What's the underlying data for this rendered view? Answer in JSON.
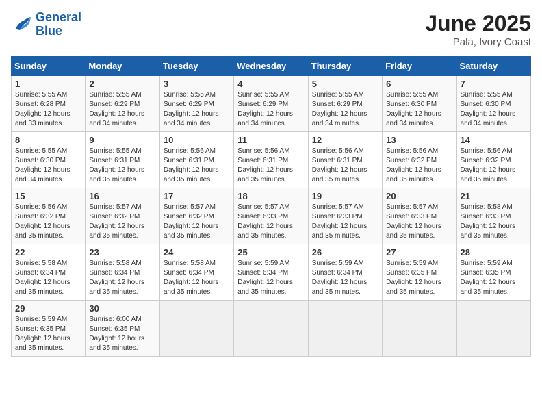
{
  "header": {
    "logo_line1": "General",
    "logo_line2": "Blue",
    "month_year": "June 2025",
    "location": "Pala, Ivory Coast"
  },
  "weekdays": [
    "Sunday",
    "Monday",
    "Tuesday",
    "Wednesday",
    "Thursday",
    "Friday",
    "Saturday"
  ],
  "weeks": [
    [
      {
        "day": "1",
        "sunrise": "5:55 AM",
        "sunset": "6:28 PM",
        "daylight": "12 hours and 33 minutes."
      },
      {
        "day": "2",
        "sunrise": "5:55 AM",
        "sunset": "6:29 PM",
        "daylight": "12 hours and 34 minutes."
      },
      {
        "day": "3",
        "sunrise": "5:55 AM",
        "sunset": "6:29 PM",
        "daylight": "12 hours and 34 minutes."
      },
      {
        "day": "4",
        "sunrise": "5:55 AM",
        "sunset": "6:29 PM",
        "daylight": "12 hours and 34 minutes."
      },
      {
        "day": "5",
        "sunrise": "5:55 AM",
        "sunset": "6:29 PM",
        "daylight": "12 hours and 34 minutes."
      },
      {
        "day": "6",
        "sunrise": "5:55 AM",
        "sunset": "6:30 PM",
        "daylight": "12 hours and 34 minutes."
      },
      {
        "day": "7",
        "sunrise": "5:55 AM",
        "sunset": "6:30 PM",
        "daylight": "12 hours and 34 minutes."
      }
    ],
    [
      {
        "day": "8",
        "sunrise": "5:55 AM",
        "sunset": "6:30 PM",
        "daylight": "12 hours and 34 minutes."
      },
      {
        "day": "9",
        "sunrise": "5:55 AM",
        "sunset": "6:31 PM",
        "daylight": "12 hours and 35 minutes."
      },
      {
        "day": "10",
        "sunrise": "5:56 AM",
        "sunset": "6:31 PM",
        "daylight": "12 hours and 35 minutes."
      },
      {
        "day": "11",
        "sunrise": "5:56 AM",
        "sunset": "6:31 PM",
        "daylight": "12 hours and 35 minutes."
      },
      {
        "day": "12",
        "sunrise": "5:56 AM",
        "sunset": "6:31 PM",
        "daylight": "12 hours and 35 minutes."
      },
      {
        "day": "13",
        "sunrise": "5:56 AM",
        "sunset": "6:32 PM",
        "daylight": "12 hours and 35 minutes."
      },
      {
        "day": "14",
        "sunrise": "5:56 AM",
        "sunset": "6:32 PM",
        "daylight": "12 hours and 35 minutes."
      }
    ],
    [
      {
        "day": "15",
        "sunrise": "5:56 AM",
        "sunset": "6:32 PM",
        "daylight": "12 hours and 35 minutes."
      },
      {
        "day": "16",
        "sunrise": "5:57 AM",
        "sunset": "6:32 PM",
        "daylight": "12 hours and 35 minutes."
      },
      {
        "day": "17",
        "sunrise": "5:57 AM",
        "sunset": "6:32 PM",
        "daylight": "12 hours and 35 minutes."
      },
      {
        "day": "18",
        "sunrise": "5:57 AM",
        "sunset": "6:33 PM",
        "daylight": "12 hours and 35 minutes."
      },
      {
        "day": "19",
        "sunrise": "5:57 AM",
        "sunset": "6:33 PM",
        "daylight": "12 hours and 35 minutes."
      },
      {
        "day": "20",
        "sunrise": "5:57 AM",
        "sunset": "6:33 PM",
        "daylight": "12 hours and 35 minutes."
      },
      {
        "day": "21",
        "sunrise": "5:58 AM",
        "sunset": "6:33 PM",
        "daylight": "12 hours and 35 minutes."
      }
    ],
    [
      {
        "day": "22",
        "sunrise": "5:58 AM",
        "sunset": "6:34 PM",
        "daylight": "12 hours and 35 minutes."
      },
      {
        "day": "23",
        "sunrise": "5:58 AM",
        "sunset": "6:34 PM",
        "daylight": "12 hours and 35 minutes."
      },
      {
        "day": "24",
        "sunrise": "5:58 AM",
        "sunset": "6:34 PM",
        "daylight": "12 hours and 35 minutes."
      },
      {
        "day": "25",
        "sunrise": "5:59 AM",
        "sunset": "6:34 PM",
        "daylight": "12 hours and 35 minutes."
      },
      {
        "day": "26",
        "sunrise": "5:59 AM",
        "sunset": "6:34 PM",
        "daylight": "12 hours and 35 minutes."
      },
      {
        "day": "27",
        "sunrise": "5:59 AM",
        "sunset": "6:35 PM",
        "daylight": "12 hours and 35 minutes."
      },
      {
        "day": "28",
        "sunrise": "5:59 AM",
        "sunset": "6:35 PM",
        "daylight": "12 hours and 35 minutes."
      }
    ],
    [
      {
        "day": "29",
        "sunrise": "5:59 AM",
        "sunset": "6:35 PM",
        "daylight": "12 hours and 35 minutes."
      },
      {
        "day": "30",
        "sunrise": "6:00 AM",
        "sunset": "6:35 PM",
        "daylight": "12 hours and 35 minutes."
      },
      null,
      null,
      null,
      null,
      null
    ]
  ]
}
